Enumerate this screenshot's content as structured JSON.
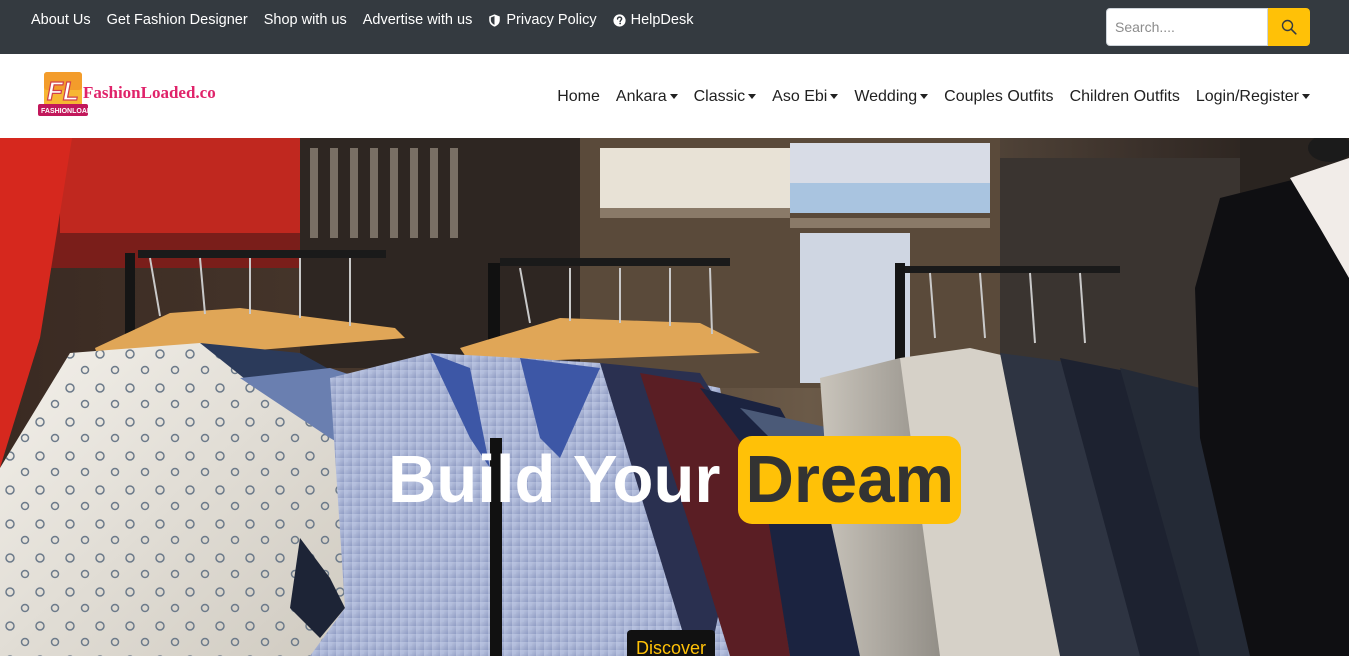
{
  "topbar": {
    "links": [
      {
        "label": "About Us"
      },
      {
        "label": "Get Fashion Designer"
      },
      {
        "label": "Shop with us"
      },
      {
        "label": "Advertise with us"
      },
      {
        "label": "Privacy Policy",
        "icon": "shield-icon"
      },
      {
        "label": "HelpDesk",
        "icon": "question-circle-icon"
      }
    ],
    "search": {
      "placeholder": "Search....",
      "value": "",
      "button_icon": "search-icon"
    }
  },
  "brand": {
    "logo_text": "FashionLoaded.com",
    "logo_mark": "FL",
    "logo_badge": "FASHIONLOADED"
  },
  "nav": {
    "items": [
      {
        "label": "Home",
        "dropdown": false
      },
      {
        "label": "Ankara",
        "dropdown": true
      },
      {
        "label": "Classic",
        "dropdown": true
      },
      {
        "label": "Aso Ebi",
        "dropdown": true
      },
      {
        "label": "Wedding",
        "dropdown": true
      },
      {
        "label": "Couples Outfits",
        "dropdown": false
      },
      {
        "label": "Children Outfits",
        "dropdown": false
      },
      {
        "label": "Login/Register",
        "dropdown": true
      }
    ]
  },
  "hero": {
    "title_main": "Build Your",
    "title_highlight": "Dream",
    "cta_label": "Discover"
  },
  "colors": {
    "topbar_bg": "#343a40",
    "accent": "#ffc107",
    "highlight_text": "#333333"
  }
}
